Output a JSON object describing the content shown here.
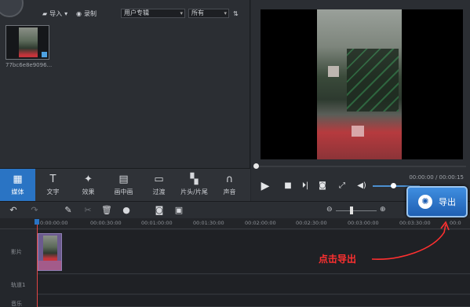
{
  "media_panel": {
    "import_label": "导入",
    "record_label": "录制",
    "category_select": "用户专辑",
    "filter_select": "所有",
    "media_item_name": "77bc6e8e9096..."
  },
  "preview": {
    "time_readout": "00:00:00 / 00:00:15"
  },
  "tools": [
    {
      "label": "媒体",
      "icon": "media-icon",
      "active": true
    },
    {
      "label": "文字",
      "icon": "text-icon"
    },
    {
      "label": "效果",
      "icon": "effects-wand-icon"
    },
    {
      "label": "画中画",
      "icon": "pip-icon"
    },
    {
      "label": "过渡",
      "icon": "transition-icon"
    },
    {
      "label": "片头/片尾",
      "icon": "clapper-icon"
    },
    {
      "label": "声音",
      "icon": "headphones-icon"
    }
  ],
  "export_button": {
    "label": "导出"
  },
  "timeline": {
    "ruler_ticks": [
      "0:00:00:00",
      "00:00:30:00",
      "00:01:00:00",
      "00:01:30:00",
      "00:02:00:00",
      "00:02:30:00",
      "00:03:00:00",
      "00:03:30:00",
      "00:0"
    ],
    "tracks": {
      "video_label": "影片",
      "overlay_label": "轨道1",
      "music_label": "音乐"
    }
  },
  "annotation": {
    "text": "点击导出",
    "color": "#ff3030"
  },
  "colors": {
    "accent": "#2a74c4",
    "annotation": "#ff3030"
  }
}
